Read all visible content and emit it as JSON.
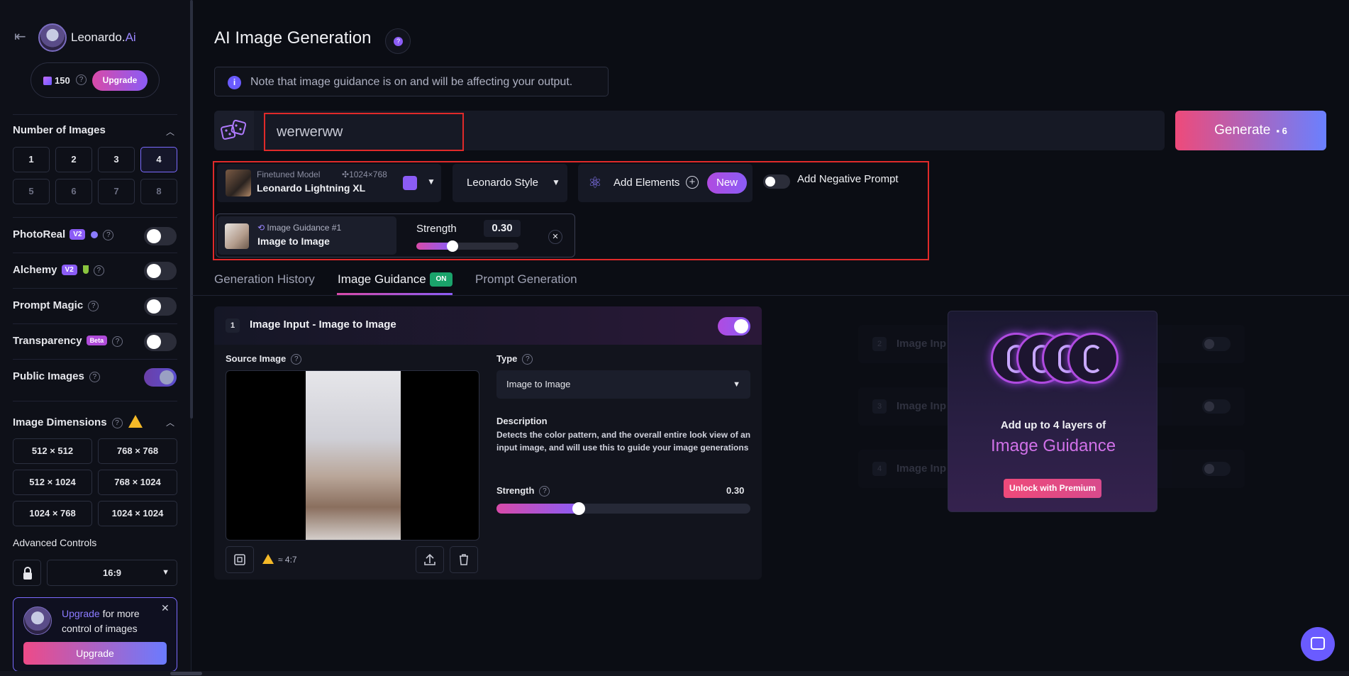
{
  "colors": {
    "accent": "#8b5cf6",
    "brand_pink": "#d84aa8",
    "highlight_box": "#e02a2a",
    "bg": "#0b0d14"
  },
  "sidebar": {
    "brand": {
      "name": "Leonardo.",
      "suffix": "Ai"
    },
    "tokens": {
      "count": "150",
      "help": "?",
      "upgrade_label": "Upgrade"
    },
    "num_images": {
      "title": "Number of Images",
      "options": [
        "1",
        "2",
        "3",
        "4",
        "5",
        "6",
        "7",
        "8"
      ],
      "selected": "4"
    },
    "photoreal": {
      "label": "PhotoReal",
      "badge": "V2"
    },
    "alchemy": {
      "label": "Alchemy",
      "badge": "V2"
    },
    "prompt_magic": {
      "label": "Prompt Magic"
    },
    "transparency": {
      "label": "Transparency",
      "badge": "Beta"
    },
    "public_images": {
      "label": "Public Images"
    },
    "dimensions": {
      "title": "Image Dimensions",
      "options": [
        "512 × 512",
        "768 × 768",
        "512 × 1024",
        "768 × 1024",
        "1024 × 768",
        "1024 × 1024"
      ]
    },
    "advanced": {
      "label": "Advanced Controls",
      "ratio": "16:9"
    },
    "upsell": {
      "link": "Upgrade",
      "text": " for more control of images",
      "button": "Upgrade"
    }
  },
  "header": {
    "title": "AI Image Generation"
  },
  "note": {
    "text": "Note that image guidance is on and will be affecting your output."
  },
  "prompt": {
    "value": "werwerww"
  },
  "generate": {
    "label": "Generate",
    "cost": "6"
  },
  "model": {
    "sub": "Finetuned Model",
    "dims": "1024×768",
    "name": "Leonardo Lightning XL"
  },
  "style": {
    "label": "Leonardo Style"
  },
  "elements": {
    "label": "Add Elements",
    "badge": "New"
  },
  "negative": {
    "label": "Add Negative Prompt"
  },
  "guidance_chip": {
    "sub": "Image Guidance #1",
    "name": "Image to Image",
    "strength_label": "Strength",
    "strength": "0.30",
    "strength_value": 0.3
  },
  "tabs": [
    {
      "label": "Generation History"
    },
    {
      "label": "Image Guidance",
      "badge": "ON"
    },
    {
      "label": "Prompt Generation"
    }
  ],
  "panel": {
    "num": "1",
    "title": "Image Input - Image to Image",
    "source_label": "Source Image",
    "aspect": "≈ 4:7",
    "type_label": "Type",
    "type_value": "Image to Image",
    "desc_label": "Description",
    "desc_text": "Detects the color pattern, and the overall entire look view of an input image, and will use this to guide your image generations",
    "strength_label": "Strength",
    "strength": "0.30",
    "strength_value": 0.3
  },
  "ghost_layers": [
    {
      "num": "2",
      "label": "Image Inp"
    },
    {
      "num": "3",
      "label": "Image Inp"
    },
    {
      "num": "4",
      "label": "Image Inp"
    }
  ],
  "promo": {
    "line1": "Add up to 4 layers of",
    "line2": "Image Guidance",
    "button": "Unlock with Premium"
  }
}
